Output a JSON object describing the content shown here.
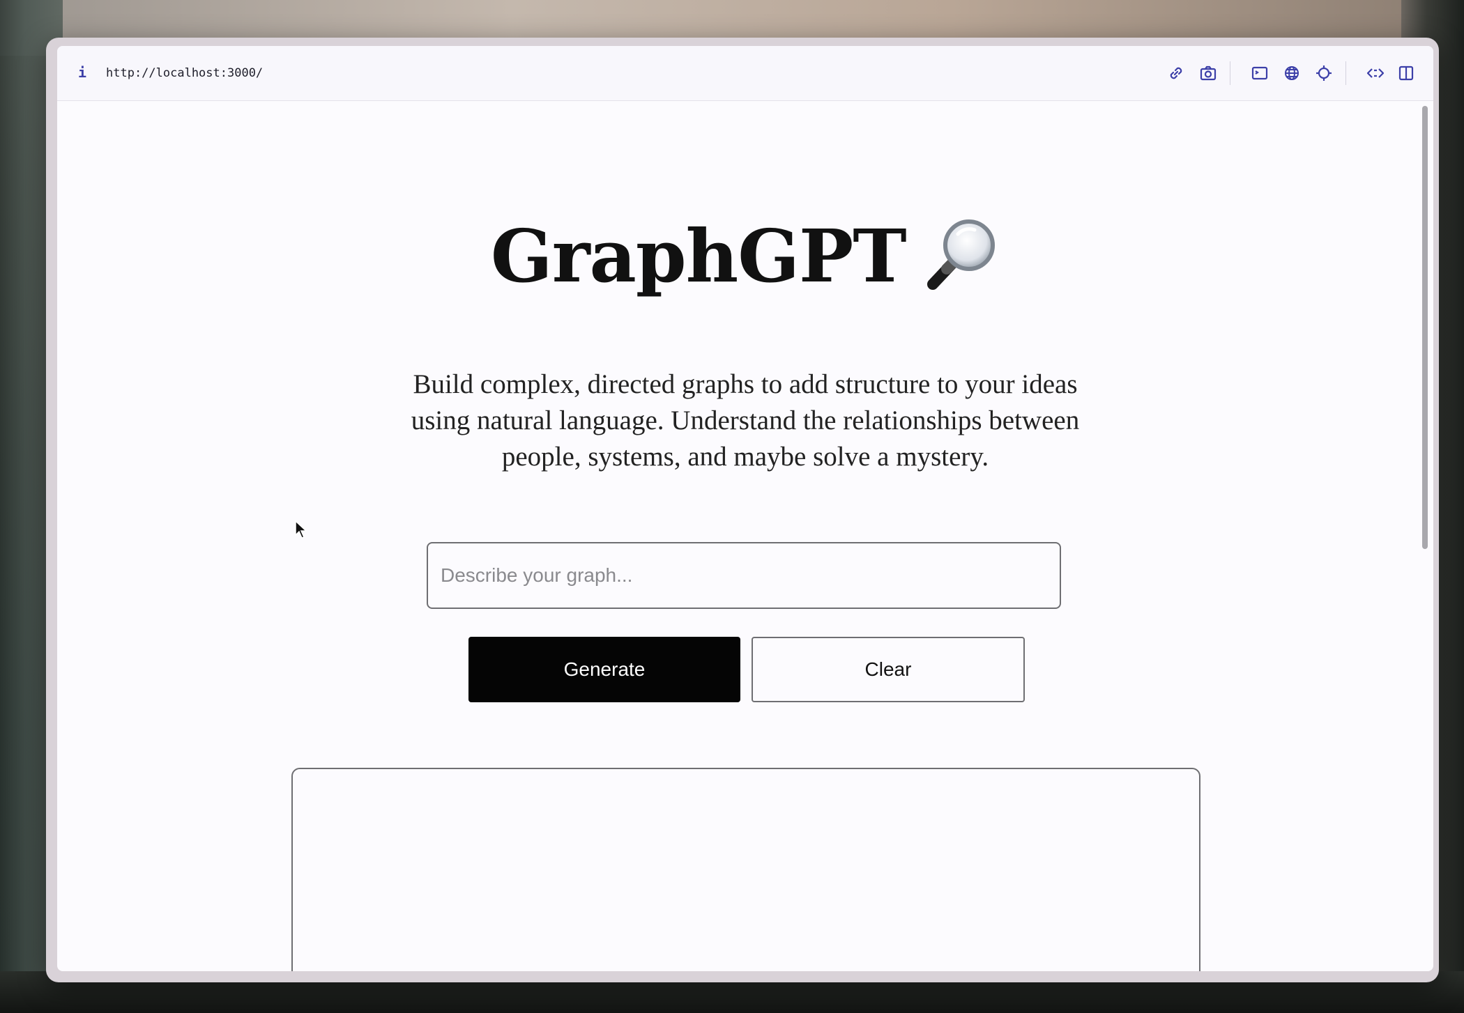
{
  "browser": {
    "url": "http://localhost:3000/",
    "toolbar_icons": [
      "link-icon",
      "screenshot-icon",
      "console-icon",
      "globe-icon",
      "target-icon",
      "code-icon",
      "split-view-icon"
    ]
  },
  "page": {
    "title": "GraphGPT",
    "title_icon": "magnifying-glass-icon",
    "tagline": "Build complex, directed graphs to add structure to your ideas using natural language. Understand the relationships between people, systems, and maybe solve a mystery.",
    "search": {
      "placeholder": "Describe your graph...",
      "value": ""
    },
    "buttons": {
      "generate_label": "Generate",
      "clear_label": "Clear"
    }
  },
  "colors": {
    "accent": "#3c3fa8",
    "primary_button": "#050505",
    "page_background": "#fcfbfe"
  }
}
